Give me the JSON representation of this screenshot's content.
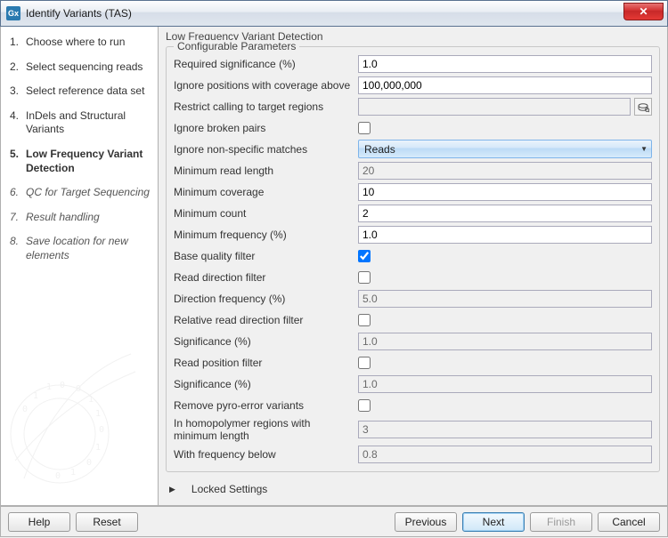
{
  "window": {
    "title": "Identify Variants (TAS)"
  },
  "steps": [
    {
      "num": "1.",
      "label": "Choose where to run",
      "state": "past"
    },
    {
      "num": "2.",
      "label": "Select sequencing reads",
      "state": "past"
    },
    {
      "num": "3.",
      "label": "Select reference data set",
      "state": "past"
    },
    {
      "num": "4.",
      "label": "InDels and Structural Variants",
      "state": "past"
    },
    {
      "num": "5.",
      "label": "Low Frequency Variant Detection",
      "state": "current"
    },
    {
      "num": "6.",
      "label": "QC for Target Sequencing",
      "state": "future"
    },
    {
      "num": "7.",
      "label": "Result handling",
      "state": "future"
    },
    {
      "num": "8.",
      "label": "Save location for new elements",
      "state": "future"
    }
  ],
  "section": {
    "title": "Low Frequency Variant Detection",
    "group": "Configurable Parameters"
  },
  "params": {
    "required_significance": {
      "label": "Required significance (%)",
      "value": "1.0",
      "enabled": true,
      "type": "text"
    },
    "ignore_coverage_above": {
      "label": "Ignore positions with coverage above",
      "value": "100,000,000",
      "enabled": true,
      "type": "text"
    },
    "restrict_target": {
      "label": "Restrict calling to target regions",
      "value": "",
      "enabled": true,
      "type": "browse"
    },
    "ignore_broken_pairs": {
      "label": "Ignore broken pairs",
      "checked": false,
      "enabled": true,
      "type": "check"
    },
    "ignore_nonspecific": {
      "label": "Ignore non-specific matches",
      "value": "Reads",
      "enabled": true,
      "type": "select"
    },
    "min_read_length": {
      "label": "Minimum read length",
      "value": "20",
      "enabled": false,
      "type": "text"
    },
    "min_coverage": {
      "label": "Minimum coverage",
      "value": "10",
      "enabled": true,
      "type": "text"
    },
    "min_count": {
      "label": "Minimum count",
      "value": "2",
      "enabled": true,
      "type": "text"
    },
    "min_frequency": {
      "label": "Minimum frequency (%)",
      "value": "1.0",
      "enabled": true,
      "type": "text"
    },
    "base_quality_filter": {
      "label": "Base quality filter",
      "checked": true,
      "enabled": true,
      "type": "check"
    },
    "read_direction_filter": {
      "label": "Read direction filter",
      "checked": false,
      "enabled": true,
      "type": "check"
    },
    "direction_frequency": {
      "label": "Direction frequency (%)",
      "value": "5.0",
      "enabled": false,
      "type": "text"
    },
    "rel_read_dir_filter": {
      "label": "Relative read direction filter",
      "checked": false,
      "enabled": true,
      "type": "check"
    },
    "significance1": {
      "label": "Significance (%)",
      "value": "1.0",
      "enabled": false,
      "type": "text"
    },
    "read_position_filter": {
      "label": "Read position filter",
      "checked": false,
      "enabled": true,
      "type": "check"
    },
    "significance2": {
      "label": "Significance (%)",
      "value": "1.0",
      "enabled": false,
      "type": "text"
    },
    "remove_pyro": {
      "label": "Remove pyro-error variants",
      "checked": false,
      "enabled": true,
      "type": "check"
    },
    "homopolymer_len": {
      "label": "In homopolymer regions with minimum length",
      "value": "3",
      "enabled": false,
      "type": "text"
    },
    "freq_below": {
      "label": "With frequency below",
      "value": "0.8",
      "enabled": false,
      "type": "text"
    }
  },
  "locked": {
    "label": "Locked Settings"
  },
  "buttons": {
    "help": "Help",
    "reset": "Reset",
    "previous": "Previous",
    "next": "Next",
    "finish": "Finish",
    "cancel": "Cancel"
  }
}
